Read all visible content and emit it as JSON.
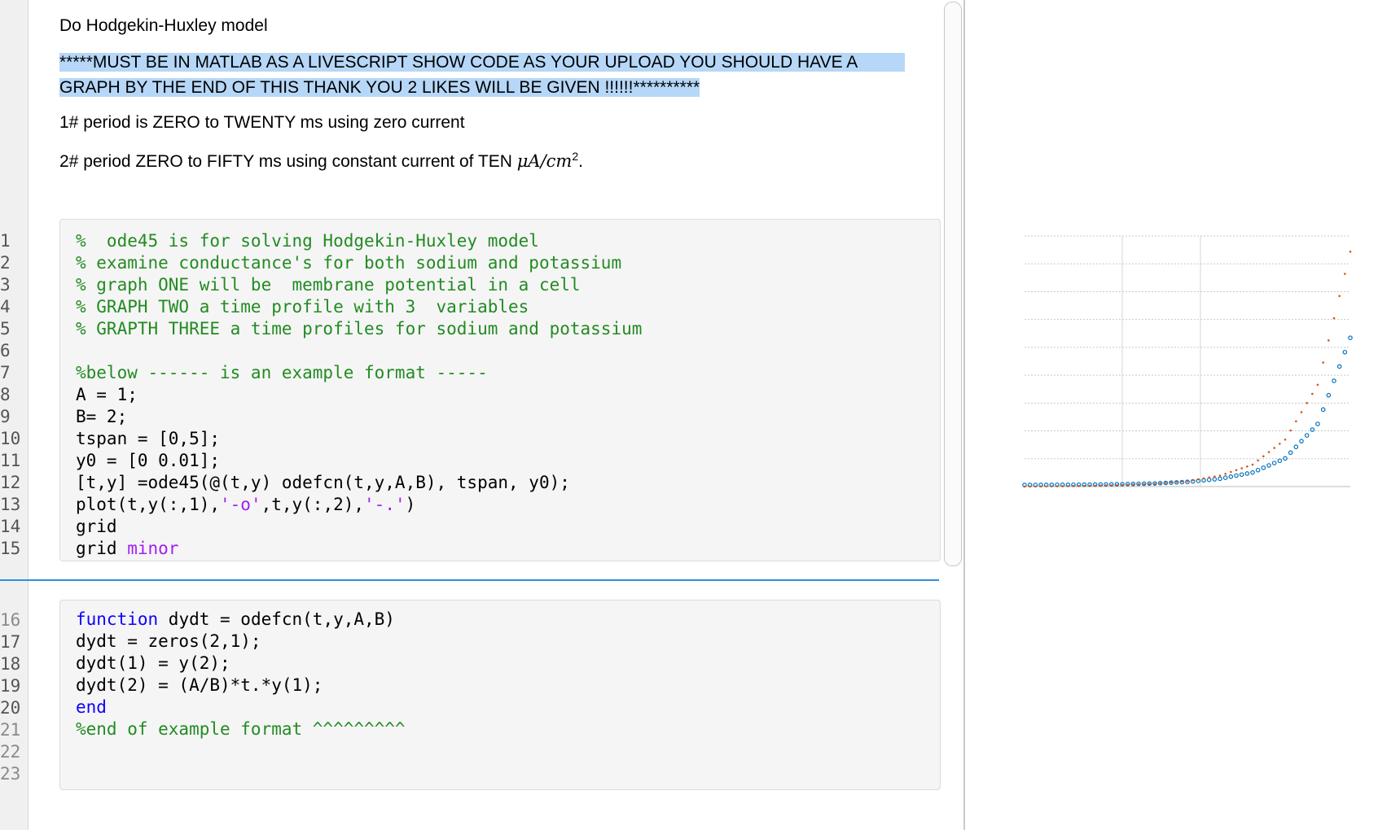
{
  "title": "Do Hodgekin-Huxley model",
  "highlight_line1": "*****MUST BE IN MATLAB AS A LIVESCRIPT SHOW CODE AS YOUR UPLOAD YOU SHOULD HAVE A",
  "highlight_line2": "GRAPH BY THE END OF THIS THANK YOU 2 LIKES WILL BE GIVEN !!!!!!**********",
  "req1": "1#  period is  ZERO  to TWENTY ms using  zero current",
  "req2_prefix": "2#  period ZERO to FIFTY ms using  constant current of TEN ",
  "req2_unit": "μA/cm",
  "req2_sup": "2",
  "req2_suffix": ".",
  "line_numbers": [
    "1",
    "2",
    "3",
    "4",
    "5",
    "6",
    "7",
    "8",
    "9",
    "10",
    "11",
    "12",
    "13",
    "14",
    "15",
    "16",
    "17",
    "18",
    "19",
    "20",
    "21",
    "22",
    "23"
  ],
  "code1": {
    "l1": "%  ode45 is for solving Hodgekin-Huxley model",
    "l2": "% examine conductance's for both sodium and potassium",
    "l3": "% graph ONE will be  membrane potential in a cell",
    "l4": "% GRAPH TWO a time profile with 3  variables",
    "l5": "% GRAPTH THREE a time profiles for sodium and potassium",
    "l7": "%below ------ is an example format -----",
    "l8": "A = 1;",
    "l9": "B= 2;",
    "l10": "tspan = [0,5];",
    "l11": "y0 = [0 0.01];",
    "l12": "[t,y] =ode45(@(t,y) odefcn(t,y,A,B), tspan, y0);",
    "l13a": "plot(t,y(:,1),",
    "l13b": "'-o'",
    "l13c": ",t,y(:,2),",
    "l13d": "'-.'",
    "l13e": ")",
    "l14": "grid",
    "l15a": "grid ",
    "l15b": "minor"
  },
  "code2": {
    "l16a": "function",
    "l16b": " dydt = odefcn(t,y,A,B)",
    "l17": "dydt = zeros(2,1);",
    "l18": "dydt(1) = y(2);",
    "l19": "dydt(2) = (A/B)*t.*y(1);",
    "l20": "end",
    "l21": "%end of example format ^^^^^^^^^"
  },
  "chart_data": {
    "type": "line",
    "title": "",
    "xlabel": "",
    "ylabel": "",
    "x": [
      0,
      0.5,
      1,
      1.5,
      2,
      2.5,
      3,
      3.5,
      4,
      4.5,
      5
    ],
    "series": [
      {
        "marker": "o",
        "color": "#0072bd",
        "values": [
          0.01,
          0.011,
          0.012,
          0.015,
          0.02,
          0.03,
          0.05,
          0.09,
          0.18,
          0.4,
          0.95
        ]
      },
      {
        "marker": ".",
        "color": "#d95319",
        "values": [
          0,
          0.002,
          0.005,
          0.01,
          0.018,
          0.035,
          0.07,
          0.14,
          0.3,
          0.65,
          1.5
        ]
      }
    ],
    "grid": "minor"
  },
  "colors": {
    "comment": "#228b22",
    "keyword": "#0e00ff",
    "string": "#a020f0",
    "highlight": "#b6d7f7"
  }
}
